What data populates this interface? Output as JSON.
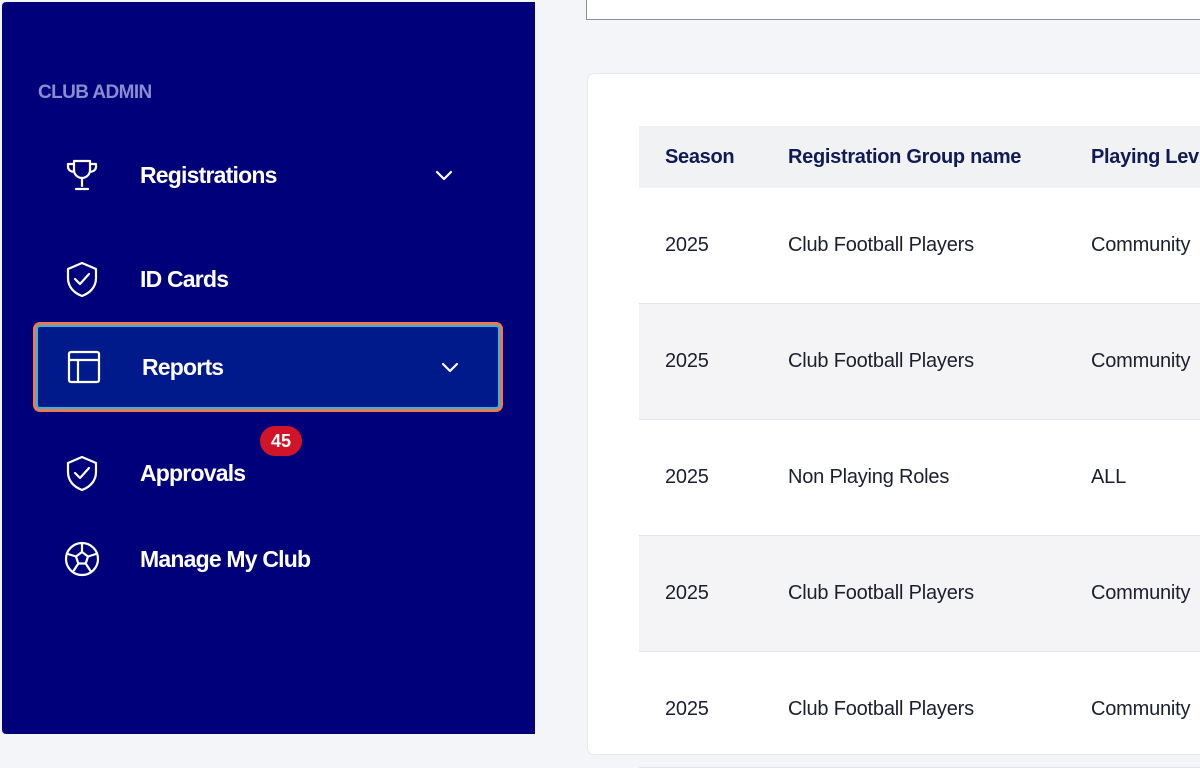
{
  "sidebar": {
    "section_label": "CLUB ADMIN",
    "items": [
      {
        "label": "Registrations",
        "icon": "trophy-icon",
        "has_chevron": true
      },
      {
        "label": "ID Cards",
        "icon": "shield-check-icon",
        "has_chevron": false
      },
      {
        "label": "Reports",
        "icon": "layout-icon",
        "has_chevron": true,
        "active": true
      },
      {
        "label": "Approvals",
        "icon": "shield-check-icon",
        "has_chevron": false,
        "badge": "45"
      },
      {
        "label": "Manage My Club",
        "icon": "football-icon",
        "has_chevron": false
      }
    ]
  },
  "table": {
    "headers": [
      "Season",
      "Registration Group name",
      "Playing Lev"
    ],
    "rows": [
      [
        "2025",
        "Club Football Players",
        "Community"
      ],
      [
        "2025",
        "Club Football Players",
        "Community"
      ],
      [
        "2025",
        "Non Playing Roles",
        "ALL"
      ],
      [
        "2025",
        "Club Football Players",
        "Community"
      ],
      [
        "2025",
        "Club Football Players",
        "Community"
      ]
    ]
  },
  "colors": {
    "sidebar_bg": "#00007a",
    "active_bg": "#001a8c",
    "active_border": "#31b7de",
    "highlight_outline": "#f0784f",
    "badge_bg": "#d21428"
  }
}
